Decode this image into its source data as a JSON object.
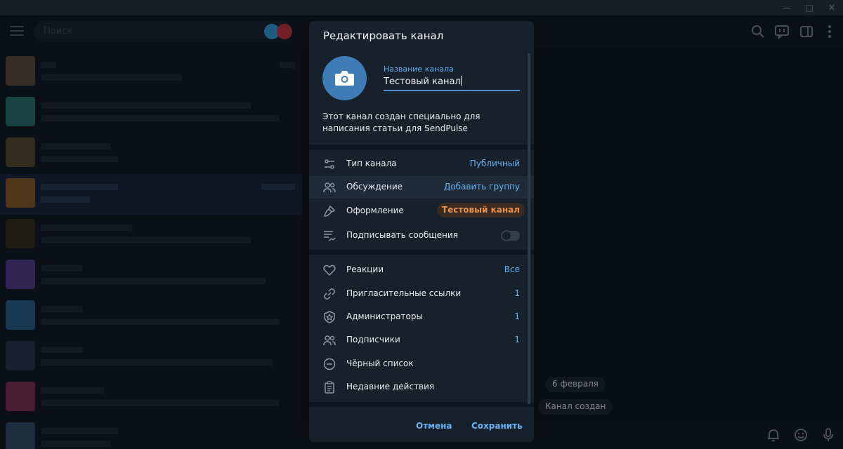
{
  "sidebar": {
    "search_placeholder": "Поиск"
  },
  "main": {
    "date_pill": "6 февраля",
    "service_message": "Канал создан"
  },
  "dialog": {
    "title": "Редактировать канал",
    "name_label": "Название канала",
    "name_value": "Тестовый канал",
    "description": "Этот канал создан специально для написания статьи для SendPulse",
    "settings": [
      {
        "icon": "settings-sliders-icon",
        "label": "Тип канала",
        "value": "Публичный"
      },
      {
        "icon": "users-icon",
        "label": "Обсуждение",
        "value": "Добавить группу"
      },
      {
        "icon": "brush-icon",
        "label": "Оформление",
        "value": "Тестовый канал"
      },
      {
        "icon": "signature-icon",
        "label": "Подписывать сообщения",
        "value": ""
      }
    ],
    "manage": [
      {
        "icon": "heart-icon",
        "label": "Реакции",
        "value": "Все"
      },
      {
        "icon": "link-icon",
        "label": "Пригласительные ссылки",
        "value": "1"
      },
      {
        "icon": "admin-shield-icon",
        "label": "Администраторы",
        "value": "1"
      },
      {
        "icon": "subscribers-icon",
        "label": "Подписчики",
        "value": "1"
      },
      {
        "icon": "blocked-icon",
        "label": "Чёрный список",
        "value": ""
      },
      {
        "icon": "clipboard-icon",
        "label": "Недавние действия",
        "value": ""
      }
    ],
    "cancel_label": "Отмена",
    "save_label": "Сохранить",
    "sign_messages_enabled": false
  },
  "colors": {
    "accent": "#6ab3f3",
    "dialog_bg": "#17212b",
    "app_bg": "#0e1621",
    "badge_text": "#e8924a"
  }
}
